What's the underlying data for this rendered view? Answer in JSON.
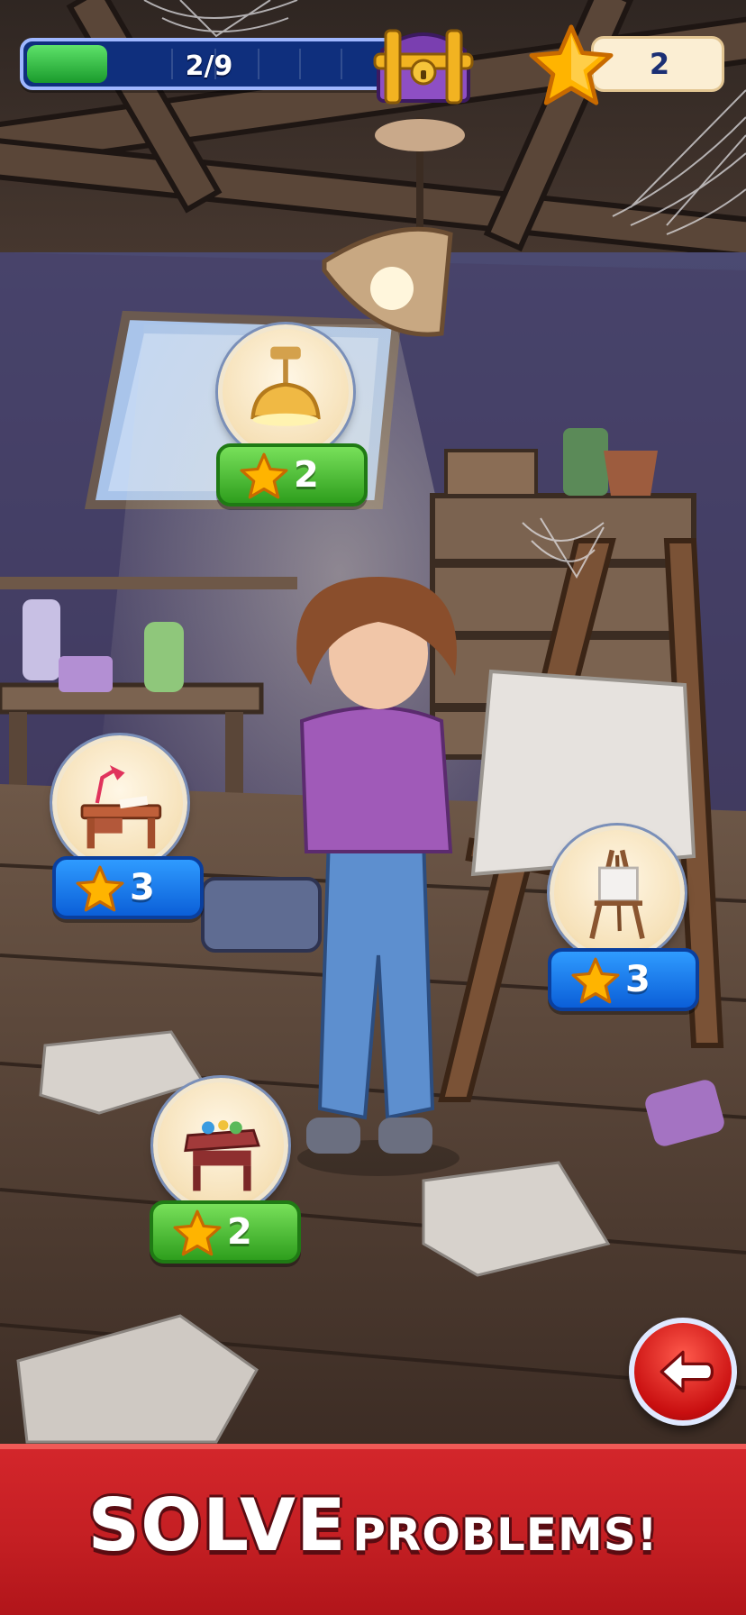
{
  "hud": {
    "progress": {
      "current": 2,
      "total": 9,
      "label": "2/9",
      "fraction": 0.222
    },
    "chest_icon": "treasure-chest-icon",
    "stars": {
      "icon": "star-icon",
      "count": "2"
    }
  },
  "tasks": [
    {
      "id": "ceiling-lamp",
      "icon": "ceiling-lamp-icon",
      "cost": "2",
      "pill_color": "green"
    },
    {
      "id": "desk",
      "icon": "desk-with-lamp-icon",
      "cost": "3",
      "pill_color": "blue"
    },
    {
      "id": "easel",
      "icon": "easel-icon",
      "cost": "3",
      "pill_color": "blue"
    },
    {
      "id": "side-table",
      "icon": "side-table-icon",
      "cost": "2",
      "pill_color": "green"
    }
  ],
  "back_button": {
    "icon": "back-arrow-icon"
  },
  "banner": {
    "line_big": "SOLVE",
    "line_small": "PROBLEMS!"
  },
  "colors": {
    "banner_red": "#c41f23",
    "pill_green": "#2e9e1d",
    "pill_blue": "#0b5fd8",
    "progress_blue": "#0f2f7d",
    "progress_green": "#1a9b2c",
    "star_gold": "#ffb400"
  }
}
